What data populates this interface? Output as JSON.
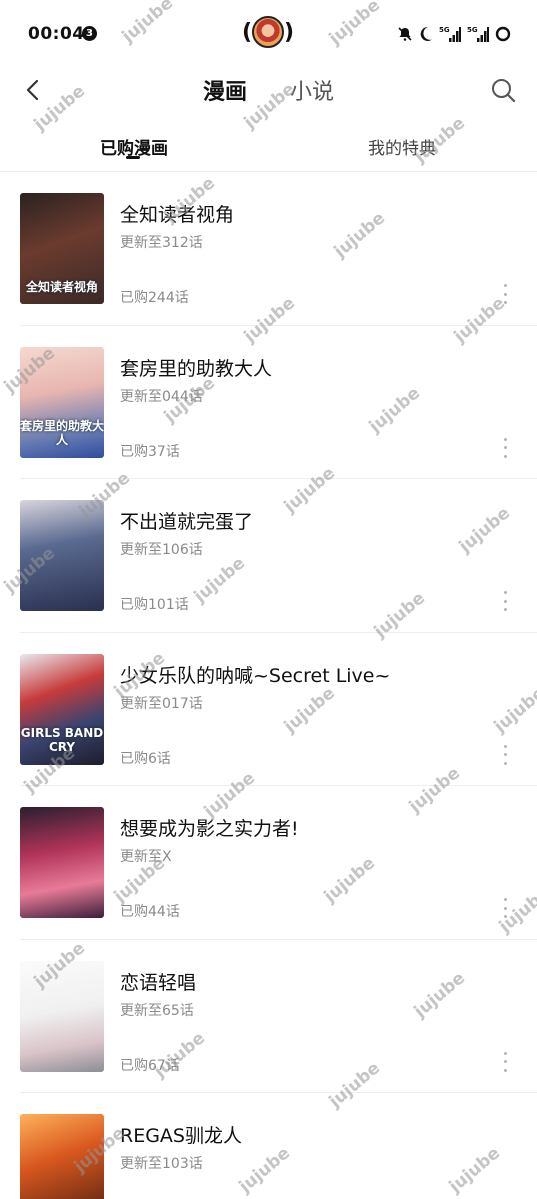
{
  "status_bar": {
    "time": "00:04",
    "notification_count": "3",
    "signal_label_1": "5G",
    "signal_label_2": "5G"
  },
  "nav": {
    "tabs": [
      {
        "label": "漫画",
        "active": true
      },
      {
        "label": "小说",
        "active": false
      }
    ]
  },
  "sub_tabs": [
    {
      "label": "已购漫画",
      "active": true
    },
    {
      "label": "我的特典",
      "active": false
    }
  ],
  "comics": [
    {
      "title": "全知读者视角",
      "update": "更新至312话",
      "bought": "已购244话",
      "cover_text": "全知读者视角"
    },
    {
      "title": "套房里的助教大人",
      "update": "更新至044话",
      "bought": "已购37话",
      "cover_text": "套房里的助教大人"
    },
    {
      "title": "不出道就完蛋了",
      "update": "更新至106话",
      "bought": "已购101话",
      "cover_text": ""
    },
    {
      "title": "少女乐队的呐喊~Secret Live~",
      "update": "更新至017话",
      "bought": "已购6话",
      "cover_text": "GIRLS BAND CRY"
    },
    {
      "title": "想要成为影之实力者!",
      "update": "更新至X",
      "bought": "已购44话",
      "cover_text": ""
    },
    {
      "title": "恋语轻唱",
      "update": "更新至65话",
      "bought": "已购67话",
      "cover_text": ""
    },
    {
      "title": "REGAS驯龙人",
      "update": "更新至103话",
      "bought": "",
      "cover_text": ""
    }
  ],
  "watermark": "jujube"
}
